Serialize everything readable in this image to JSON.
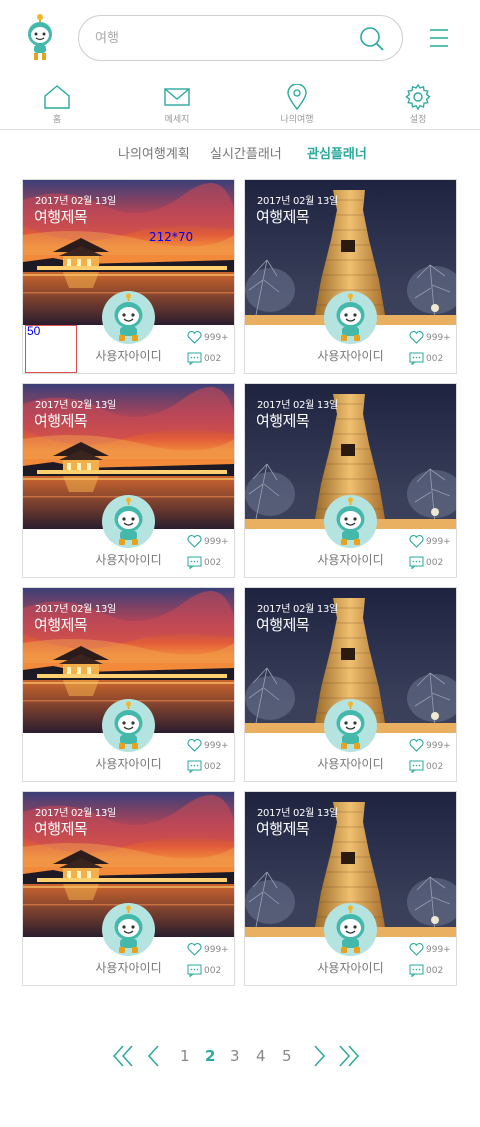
{
  "header": {
    "search_placeholder": "여행",
    "logo_icon": "mascot-logo-icon",
    "search_icon": "search-icon",
    "menu_icon": "hamburger-menu-icon"
  },
  "nav": {
    "items": [
      {
        "label": "홈",
        "icon": "home-icon"
      },
      {
        "label": "메세지",
        "icon": "mail-icon"
      },
      {
        "label": "나의여행",
        "icon": "location-pin-icon"
      },
      {
        "label": "설정",
        "icon": "gear-icon"
      }
    ]
  },
  "tabs": [
    {
      "label": "나의여행계획",
      "active": false
    },
    {
      "label": "실시간플래너",
      "active": false
    },
    {
      "label": "관심플래너",
      "active": true
    }
  ],
  "cards": [
    {
      "date": "2017년 02월 13일",
      "title": "여행제목",
      "user": "사용자아이디",
      "likes": "999+",
      "comments": "002",
      "photo": "palace"
    },
    {
      "date": "2017년 02월 13일",
      "title": "여행제목",
      "user": "사용자아이디",
      "likes": "999+",
      "comments": "002",
      "photo": "tower"
    },
    {
      "date": "2017년 02월 13일",
      "title": "여행제목",
      "user": "사용자아이디",
      "likes": "999+",
      "comments": "002",
      "photo": "palace"
    },
    {
      "date": "2017년 02월 13일",
      "title": "여행제목",
      "user": "사용자아이디",
      "likes": "999+",
      "comments": "002",
      "photo": "tower"
    },
    {
      "date": "2017년 02월 13일",
      "title": "여행제목",
      "user": "사용자아이디",
      "likes": "999+",
      "comments": "002",
      "photo": "palace"
    },
    {
      "date": "2017년 02월 13일",
      "title": "여행제목",
      "user": "사용자아이디",
      "likes": "999+",
      "comments": "002",
      "photo": "tower"
    },
    {
      "date": "2017년 02월 13일",
      "title": "여행제목",
      "user": "사용자아이디",
      "likes": "999+",
      "comments": "002",
      "photo": "palace"
    },
    {
      "date": "2017년 02월 13일",
      "title": "여행제목",
      "user": "사용자아이디",
      "likes": "999+",
      "comments": "002",
      "photo": "tower"
    }
  ],
  "dev_annotations": {
    "size_note": "212*70",
    "box_note": "50"
  },
  "pagination": {
    "pages": [
      "1",
      "2",
      "3",
      "4",
      "5"
    ],
    "current": "2",
    "first_icon": "double-chevron-left-icon",
    "prev_icon": "chevron-left-icon",
    "next_icon": "chevron-right-icon",
    "last_icon": "double-chevron-right-icon"
  },
  "colors": {
    "accent": "#2aa99c",
    "border": "#dcdcdc"
  }
}
